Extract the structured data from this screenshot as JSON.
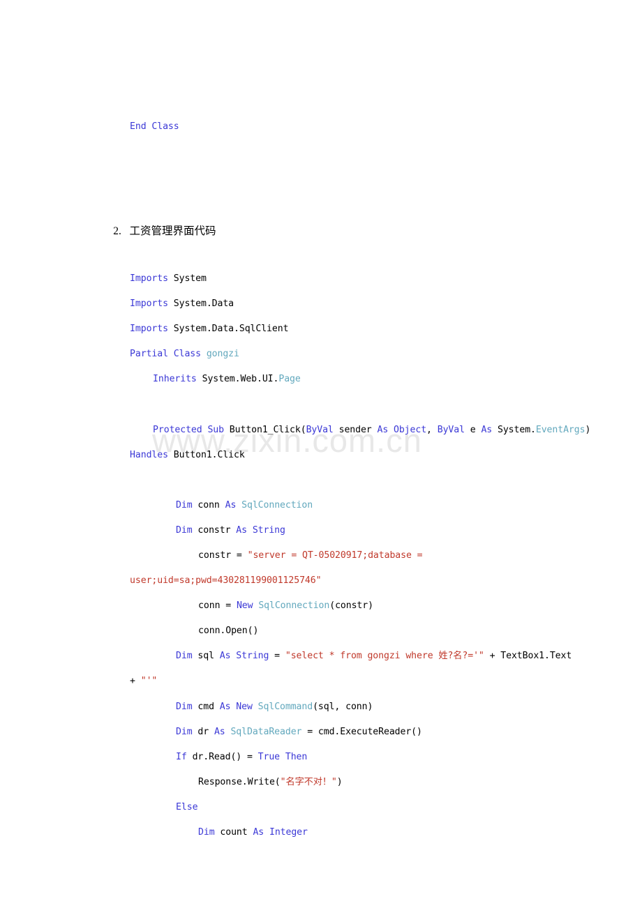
{
  "document": {
    "watermark_text": "www.zixin.com.cn",
    "colors": {
      "keyword": "#3b38d6",
      "type": "#62a8bd",
      "string": "#c0392b",
      "plain": "#000000",
      "watermark": "#e8e8e8",
      "page_background": "#ffffff"
    },
    "heading": {
      "number": "2.",
      "title": "工资管理界面代码"
    },
    "code": {
      "end_class": {
        "keyword": "End Class"
      },
      "line_imports_system": {
        "kw": "Imports",
        "rest": " System"
      },
      "line_imports_system_data": {
        "kw": "Imports",
        "rest": " System.Data"
      },
      "line_imports_sqlclient": {
        "kw": "Imports",
        "rest": " System.Data.SqlClient"
      },
      "line_partial_class": {
        "kw": "Partial Class ",
        "type": "gongzi"
      },
      "line_inherits": {
        "kw": "Inherits",
        "plain": " System.Web.UI.",
        "type": "Page"
      },
      "line_protected_sub_a": {
        "kw1": "Protected Sub",
        "p1": " Button1_Click(",
        "kw2": "ByVal",
        "p2": " sender ",
        "kw3": "As Object",
        "p3": ", ",
        "kw4": "ByVal",
        "p4": " e ",
        "kw5": "As",
        "p5": " System.",
        "type": "EventArgs",
        "p6": ")"
      },
      "line_protected_sub_b": {
        "kw": "Handles",
        "plain": " Button1.Click"
      },
      "line_dim_conn": {
        "kw1": "Dim",
        "p1": " conn ",
        "kw2": "As",
        "p2": " ",
        "type": "SqlConnection"
      },
      "line_dim_constr": {
        "kw1": "Dim",
        "p1": " constr ",
        "kw2": "As String"
      },
      "line_constr_assign_a": {
        "plain": "constr = ",
        "string": "\"server = QT-05020917;database ="
      },
      "line_constr_assign_b": {
        "string": "user;uid=sa;pwd=430281199001125746\""
      },
      "line_conn_new": {
        "p1": "conn = ",
        "kw": "New",
        "p2": " ",
        "type": "SqlConnection",
        "p3": "(constr)"
      },
      "line_conn_open": {
        "plain": "conn.Open()"
      },
      "line_dim_sql_a": {
        "kw1": "Dim",
        "p1": " sql ",
        "kw2": "As String",
        "p2": " = ",
        "string": "\"select * from gongzi where 姓?名?='\"",
        "p3": " + TextBox1.Text"
      },
      "line_dim_sql_b": {
        "plain": "+ ",
        "string": "\"'\""
      },
      "line_dim_cmd": {
        "kw1": "Dim",
        "p1": " cmd ",
        "kw2": "As New",
        "p2": " ",
        "type": "SqlCommand",
        "p3": "(sql, conn)"
      },
      "line_dim_dr": {
        "kw1": "Dim",
        "p1": " dr ",
        "kw2": "As",
        "p2": " ",
        "type": "SqlDataReader",
        "p3": " = cmd.ExecuteReader()"
      },
      "line_if_read": {
        "kw1": "If",
        "p1": " dr.Read() = ",
        "kw2": "True Then"
      },
      "line_response_write": {
        "p1": "Response.Write(",
        "string": "\"名字不对！\"",
        "p2": ")"
      },
      "line_else": {
        "kw": "Else"
      },
      "line_dim_count": {
        "kw1": "Dim",
        "p1": " count ",
        "kw2": "As Integer"
      }
    }
  }
}
